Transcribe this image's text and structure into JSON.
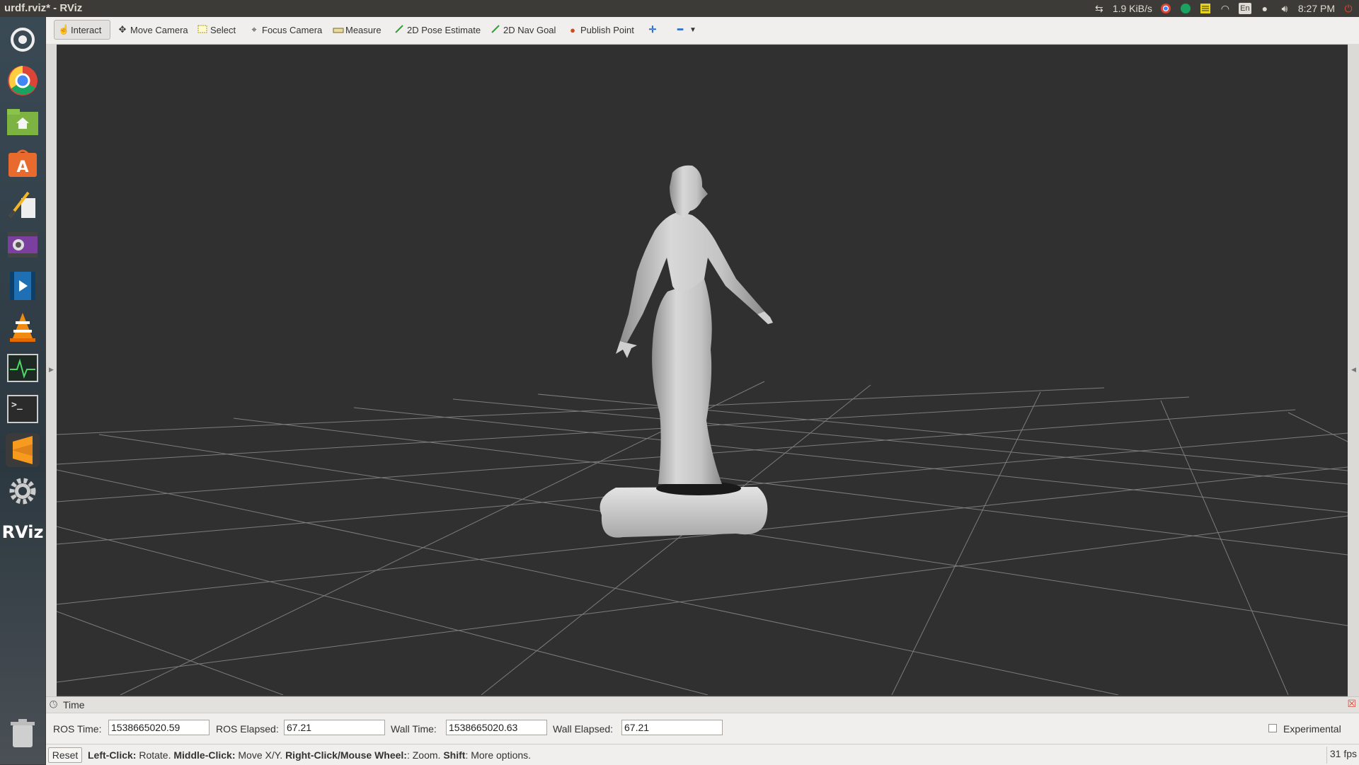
{
  "window": {
    "title": "urdf.rviz* - RViz"
  },
  "tray": {
    "network_speed": "1.9 KiB/s",
    "keyboard": "En",
    "clock": "8:27 PM"
  },
  "launcher": {
    "rviz_label": "RViz"
  },
  "toolbar": {
    "interact": "Interact",
    "move_camera": "Move Camera",
    "select": "Select",
    "focus_camera": "Focus Camera",
    "measure": "Measure",
    "pose_estimate": "2D Pose Estimate",
    "nav_goal": "2D Nav Goal",
    "publish_point": "Publish Point"
  },
  "time_panel": {
    "title": "Time",
    "ros_time_label": "ROS Time:",
    "ros_time": "1538665020.59",
    "ros_elapsed_label": "ROS Elapsed:",
    "ros_elapsed": "67.21",
    "wall_time_label": "Wall Time:",
    "wall_time": "1538665020.63",
    "wall_elapsed_label": "Wall Elapsed:",
    "wall_elapsed": "67.21",
    "experimental_label": "Experimental"
  },
  "status": {
    "reset": "Reset",
    "left_click_key": "Left-Click:",
    "left_click_desc": " Rotate. ",
    "middle_click_key": "Middle-Click:",
    "middle_click_desc": " Move X/Y. ",
    "right_click_key": "Right-Click/Mouse Wheel:",
    "right_click_desc": ": Zoom. ",
    "shift_key": "Shift",
    "shift_desc": ": More options.",
    "fps": "31 fps"
  },
  "colors": {
    "viewport_bg": "#303030",
    "grid_line": "#8a8a8a",
    "model": "#cfcfcf"
  }
}
